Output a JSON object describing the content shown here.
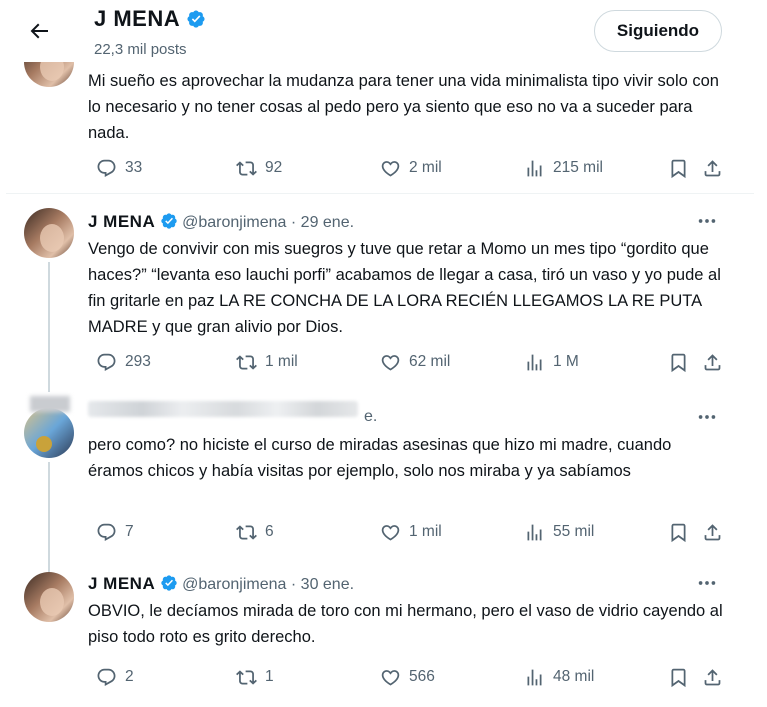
{
  "header": {
    "name": "J MENA",
    "posts": "22,3 mil posts",
    "follow_label": "Siguiendo"
  },
  "tweets": [
    {
      "text": "Mi sueño es aprovechar la mudanza para tener una vida minimalista tipo vivir solo con lo necesario y no tener cosas al pedo pero ya siento que eso no va a suceder para nada.",
      "replies": "33",
      "retweets": "92",
      "likes": "2 mil",
      "views": "215 mil"
    },
    {
      "name": "J MENA",
      "handle": "@baronjimena",
      "date": "· 29 ene.",
      "text": "Vengo de convivir con mis suegros y tuve que retar a Momo un mes tipo “gordito que haces?” “levanta eso lauchi porfi” acabamos de llegar a casa, tiró un vaso y yo pude al fin gritarle en paz LA RE CONCHA DE LA LORA RECIÉN LLEGAMOS LA RE PUTA MADRE y que gran alivio por Dios.",
      "replies": "293",
      "retweets": "1 mil",
      "likes": "62 mil",
      "views": "1 M"
    },
    {
      "date": "e.",
      "text": "pero como? no hiciste el curso de miradas asesinas que hizo mi madre, cuando éramos chicos y había visitas por ejemplo, solo nos miraba y ya sabíamos",
      "replies": "7",
      "retweets": "6",
      "likes": "1 mil",
      "views": "55 mil"
    },
    {
      "name": "J MENA",
      "handle": "@baronjimena",
      "date": "· 30 ene.",
      "text": "OBVIO, le decíamos mirada de toro con mi hermano, pero el vaso de vidrio cayendo al piso todo roto es grito derecho.",
      "replies": "2",
      "retweets": "1",
      "likes": "566",
      "views": "48 mil"
    }
  ],
  "icons": {
    "back": "arrow-left-icon",
    "verified": "verified-badge-icon",
    "more": "more-dots-icon",
    "reply": "reply-icon",
    "retweet": "retweet-icon",
    "like": "heart-icon",
    "views": "views-icon",
    "bookmark": "bookmark-icon",
    "share": "share-icon"
  },
  "colors": {
    "verified": "#1d9bf0",
    "text": "#0f1419",
    "muted": "#536471",
    "line": "#cfd9de"
  }
}
